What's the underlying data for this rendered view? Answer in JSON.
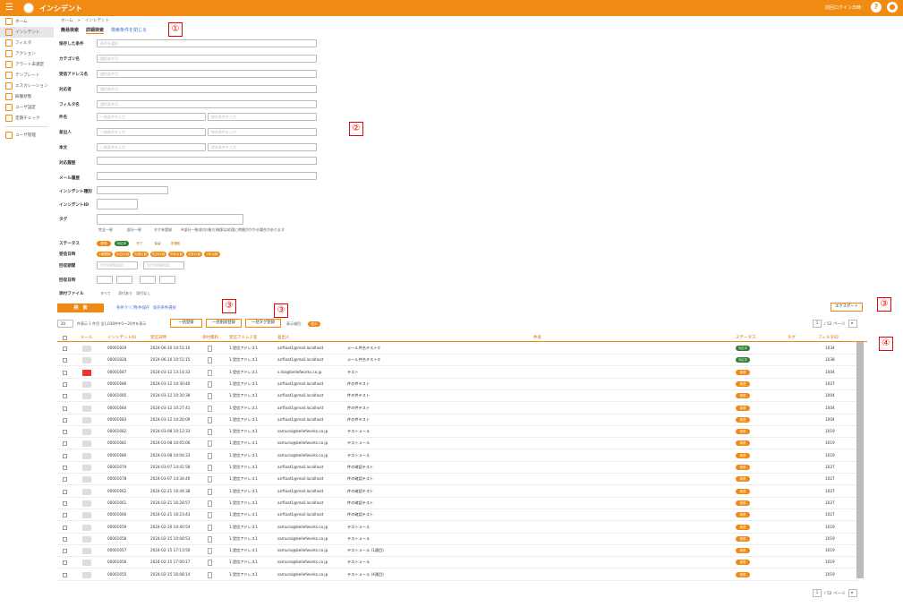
{
  "header": {
    "title": "インシデント",
    "login": "前回ログイン日時：",
    "help": "?",
    "user": "●"
  },
  "sidebar": [
    {
      "label": "ホーム"
    },
    {
      "label": "インシデント"
    },
    {
      "label": "フィルタ"
    },
    {
      "label": "アクション"
    },
    {
      "label": "アラート未選定"
    },
    {
      "label": "テンプレート"
    },
    {
      "label": "エスカレーション"
    },
    {
      "label": "稼働状態"
    },
    {
      "label": "ユーザ設定"
    },
    {
      "label": "定期チェック"
    },
    {
      "label": "ユーザ管理"
    }
  ],
  "breadcrumb": "ホーム　>　インシデント",
  "tabs": {
    "simple": "簡易検索",
    "detail": "詳細検索",
    "close": "検索条件を閉じる"
  },
  "form": {
    "saved": "保存した条件",
    "category": "カテゴリ名",
    "recv": "受信アドレス名",
    "handler": "対応者",
    "filter": "フィルタ名",
    "subject": "件名",
    "sender": "差出人",
    "body": "本文",
    "history": "対応履歴",
    "mailhist": "メール履歴",
    "type": "インシデント種別",
    "id": "インシデントID",
    "tag": "タグ",
    "status": "ステータス",
    "date": "受信日時",
    "period": "回収期間",
    "recv_date": "回収日時",
    "attach": "添付ファイル",
    "select": "条件を選択",
    "any": "選択条件可",
    "sub_ph": "一致条件を入力",
    "ex_ph": "除外条件を入力",
    "date_ph": "YYYY/MM/DD"
  },
  "match": {
    "all": "完全一致",
    "part": "部分一致",
    "tagsel": "タグ未登録",
    "note": "※部分一致(前方/後方)検索は処理に時間がかかる場合があります"
  },
  "status_pills": [
    "新規",
    "対応中",
    "完了",
    "保留",
    "非通知"
  ],
  "date_pills": [
    "1時間前",
    "今日以前",
    "今週以前",
    "先月以前",
    "今年以前",
    "去年以前",
    "1年以前"
  ],
  "attach_opts": [
    "すべて",
    "添付あり",
    "添付なし"
  ],
  "actions": {
    "search": "検　索",
    "clear": "条件クリア",
    "save": "条件保存",
    "saved": "保存条件選択",
    "bulk1": "一括登録",
    "bulk2": "一括削除登録",
    "bulk3": "一括タグ登録",
    "display": "表示項目：",
    "toggle": "表示",
    "export": "エクスポート"
  },
  "paging": {
    "per": "20",
    "info": "件表示 1 件目 全1,038件中1～20件を表示",
    "page": "1",
    "total": "/ 52 ページ"
  },
  "columns": [
    "メール",
    "インシデントID",
    "受信日時",
    "添付資料",
    "受信アドレス名",
    "差出人",
    "件名",
    "ステータス",
    "タグ",
    "フィルタID"
  ],
  "rows": [
    [
      "00001829",
      "2024-06-10 10:51:16",
      "1.受信アドレス1",
      "arrfloat1@mail.localhost",
      "メール件名テスト①",
      "対応中",
      "1034"
    ],
    [
      "00001828",
      "2024-06-10 10:51:15",
      "1.受信アドレス1",
      "arrfloat1@mail.localhost",
      "メール件名テスト②",
      "対応中",
      "1038"
    ],
    [
      "00001687",
      "2024-03-12 13:14:33",
      "1.受信アドレス1",
      "s.itoi@beliefworks.co.jp",
      "テスト",
      "新規",
      "1004"
    ],
    [
      "00001686",
      "2024-03-12 10:30:40",
      "1.受信アドレス1",
      "arrfloat1@mail.localhost",
      "件の件テスト",
      "新規",
      "1027"
    ],
    [
      "00001685",
      "2024-03-12 10:30:38",
      "1.受信アドレス1",
      "arrfloat1@mail.localhost",
      "件の件テスト",
      "新規",
      "1004"
    ],
    [
      "00001684",
      "2024-03-12 10:27:41",
      "1.受信アドレス1",
      "arrfloat1@mail.localhost",
      "件の件テスト",
      "新規",
      "1004"
    ],
    [
      "00001683",
      "2024-03-12 10:26:09",
      "1.受信アドレス1",
      "arrfloat1@mail.localhost",
      "件の件テスト",
      "新規",
      "1004"
    ],
    [
      "00001682",
      "2024-03-08 10:12:33",
      "1.受信アドレス1",
      "samurai@beliefworks.co.jp",
      "テストメール",
      "新規",
      "1019"
    ],
    [
      "00001681",
      "2024-03-08 10:05:06",
      "1.受信アドレス1",
      "samurai@beliefworks.co.jp",
      "テストメール",
      "新規",
      "1019"
    ],
    [
      "00001680",
      "2024-03-08 10:04:33",
      "1.受信アドレス1",
      "samurai@beliefworks.co.jp",
      "テストメール",
      "新規",
      "1019"
    ],
    [
      "00001679",
      "2024-03-07 14:41:58",
      "1.受信アドレス1",
      "arrfloat1@mail.localhost",
      "件の確認テスト",
      "新規",
      "1027"
    ],
    [
      "00001678",
      "2024-03-07 14:34:40",
      "1.受信アドレス1",
      "arrfloat1@mail.localhost",
      "件の確認テスト",
      "新規",
      "1027"
    ],
    [
      "00001662",
      "2024-02-21 16:44:38",
      "1.受信アドレス1",
      "arrfloat1@mail.localhost",
      "件の確認テスト",
      "新規",
      "1027"
    ],
    [
      "00001661",
      "2024-02-21 16:28:57",
      "1.受信アドレス1",
      "arrfloat1@mail.localhost",
      "件の確認テスト",
      "新規",
      "1027"
    ],
    [
      "00001660",
      "2024-02-21 16:23:43",
      "1.受信アドレス1",
      "arrfloat1@mail.localhost",
      "件の確認テスト",
      "新規",
      "1027"
    ],
    [
      "00001659",
      "2024-02-20 10:40:54",
      "1.受信アドレス1",
      "samurai@beliefworks.co.jp",
      "テストメール",
      "新規",
      "1019"
    ],
    [
      "00001658",
      "2024-02-15 10:08:53",
      "1.受信アドレス1",
      "samurai@beliefworks.co.jp",
      "テストメール",
      "新規",
      "1019"
    ],
    [
      "00001657",
      "2024-02-15 17:13:50",
      "1.受信アドレス1",
      "samurai@beliefworks.co.jp",
      "テストメール (1通目)",
      "新規",
      "1019"
    ],
    [
      "00001656",
      "2024-02-15 17:00:17",
      "1.受信アドレス1",
      "samurai@beliefworks.co.jp",
      "テストメール",
      "新規",
      "1019"
    ],
    [
      "00001655",
      "2024-02-15 16:08:14",
      "1.受信アドレス1",
      "samurai@beliefworks.co.jp",
      "テストメール (4通目)",
      "新規",
      "1019"
    ]
  ],
  "callouts": [
    "①",
    "②",
    "③",
    "③",
    "③",
    "④"
  ]
}
